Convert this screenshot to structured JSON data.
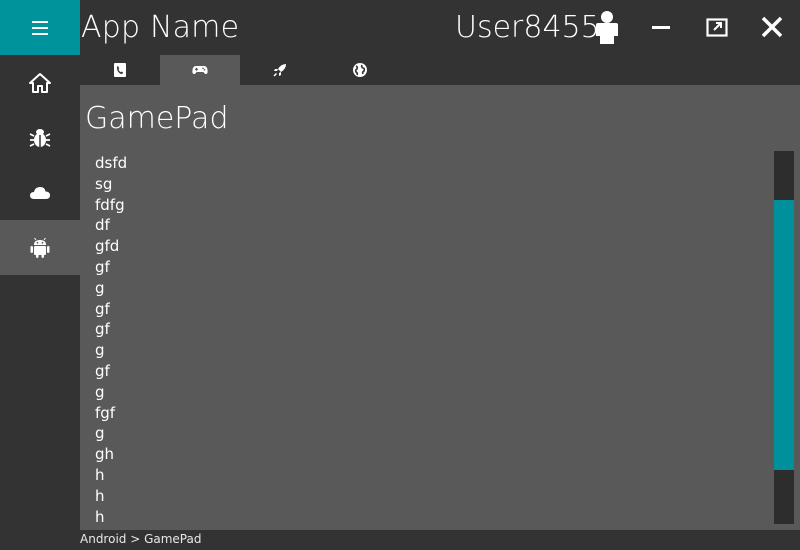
{
  "app": {
    "title": "App Name",
    "user": "User8455"
  },
  "sidebar": {
    "items": [
      {
        "icon": "home-icon"
      },
      {
        "icon": "bug-icon"
      },
      {
        "icon": "cloud-icon"
      },
      {
        "icon": "android-icon",
        "active": true
      }
    ]
  },
  "tabs": [
    {
      "icon": "phone-icon"
    },
    {
      "icon": "gamepad-icon",
      "active": true
    },
    {
      "icon": "rocket-icon"
    },
    {
      "icon": "globe-icon"
    }
  ],
  "page": {
    "title": "GamePad"
  },
  "list": {
    "items": [
      "dsfd",
      "sg",
      "fdfg",
      "df",
      "gfd",
      "gf",
      "g",
      "gf",
      "gf",
      "g",
      "gf",
      "g",
      "fgf",
      "g",
      "gh",
      "h",
      "h",
      "h"
    ]
  },
  "breadcrumb": {
    "text": "Android > GamePad"
  },
  "colors": {
    "accent": "#00939c",
    "panel": "#595959",
    "background": "#333333"
  }
}
